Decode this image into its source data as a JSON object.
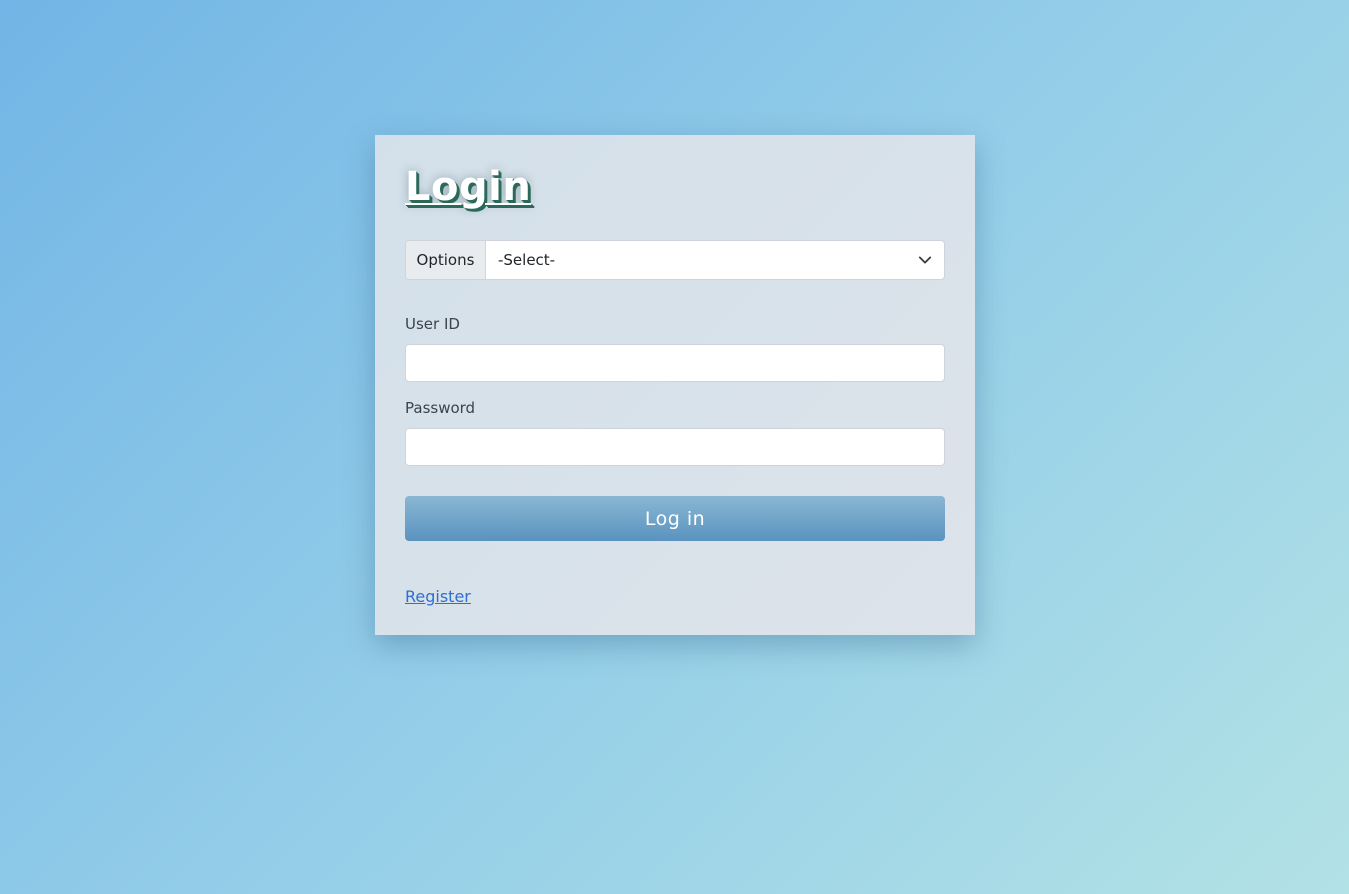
{
  "login": {
    "title": "Login",
    "options_label": "Options",
    "select": {
      "selected": "-Select-"
    },
    "user_id": {
      "label": "User ID",
      "value": "",
      "placeholder": ""
    },
    "password": {
      "label": "Password",
      "value": "",
      "placeholder": ""
    },
    "submit_label": "Log in",
    "register_link": "Register"
  },
  "icons": {
    "select_chevron": "chevron-down-icon"
  },
  "colors": {
    "background_start": "#72b5e6",
    "background_end": "#b2e2e6",
    "button_top": "#8ab7d3",
    "button_bottom": "#5a93bf",
    "link": "#2f6fcf"
  }
}
